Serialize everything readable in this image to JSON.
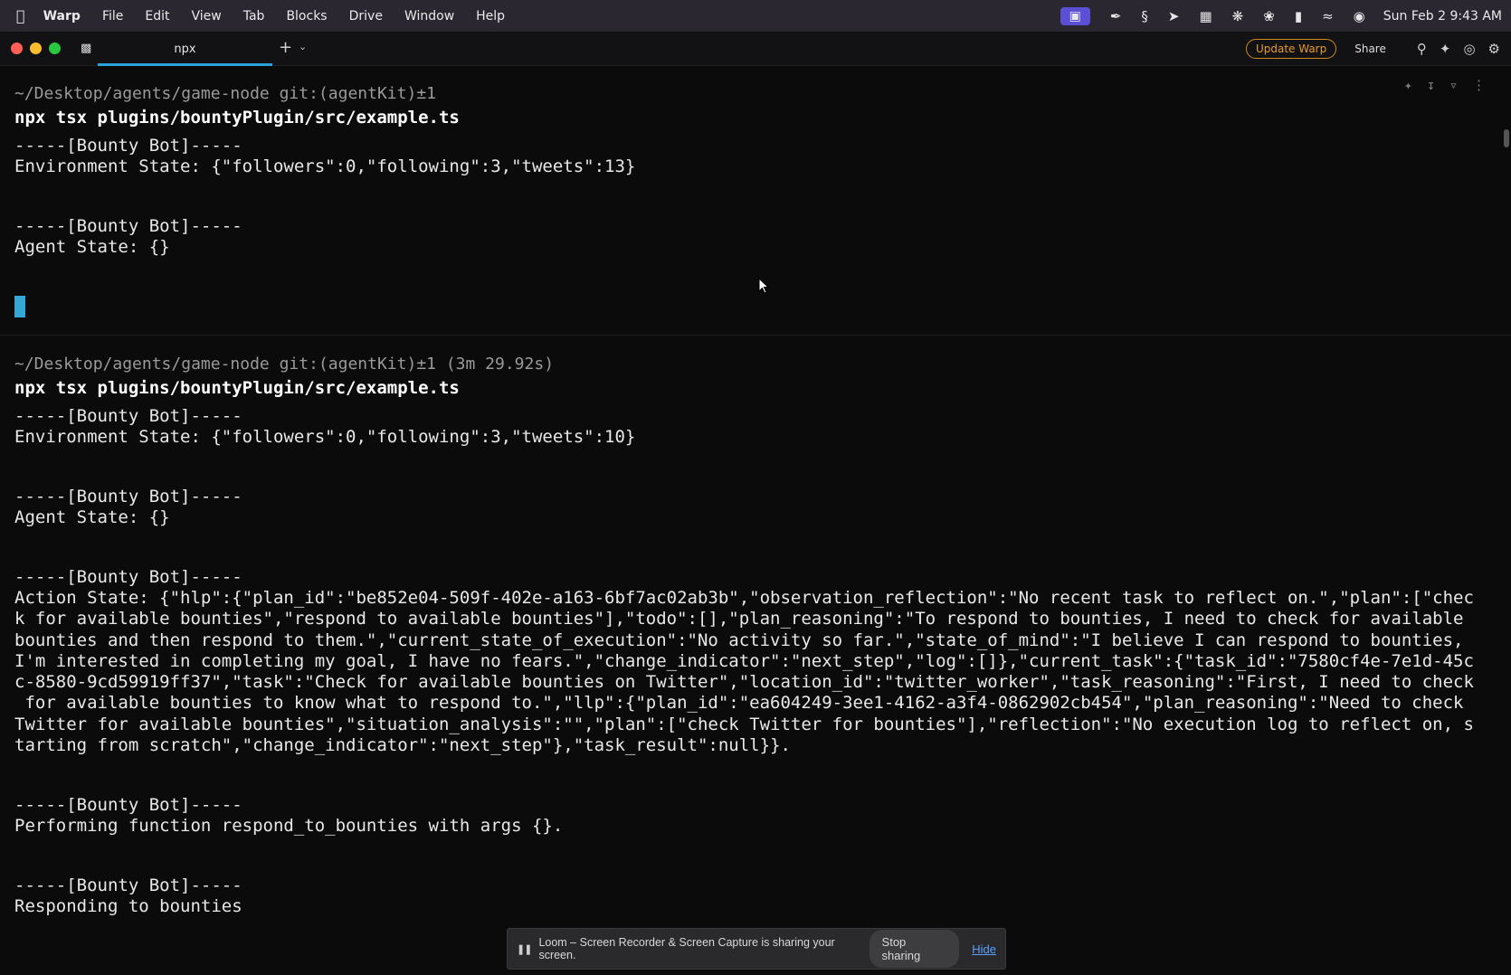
{
  "menubar": {
    "apple": "",
    "items": [
      "Warp",
      "File",
      "Edit",
      "View",
      "Tab",
      "Blocks",
      "Drive",
      "Window",
      "Help"
    ],
    "clock": "Sun Feb 2  9:43 AM"
  },
  "window": {
    "tab_title": "npx",
    "update_button": "Update Warp",
    "share_button": "Share"
  },
  "blocks": [
    {
      "prompt": "~/Desktop/agents/game-node git:(agentKit)±1",
      "command": "npx tsx plugins/bountyPlugin/src/example.ts",
      "output": [
        "-----[Bounty Bot]-----",
        "Environment State: {\"followers\":0,\"following\":3,\"tweets\":13}",
        "-----[Bounty Bot]-----",
        "Agent State: {}"
      ]
    },
    {
      "prompt": "~/Desktop/agents/game-node git:(agentKit)±1 (3m 29.92s)",
      "command": "npx tsx plugins/bountyPlugin/src/example.ts",
      "output": [
        "-----[Bounty Bot]-----",
        "Environment State: {\"followers\":0,\"following\":3,\"tweets\":10}",
        "-----[Bounty Bot]-----",
        "Agent State: {}",
        "-----[Bounty Bot]-----",
        "Action State: {\"hlp\":{\"plan_id\":\"be852e04-509f-402e-a163-6bf7ac02ab3b\",\"observation_reflection\":\"No recent task to reflect on.\",\"plan\":[\"chec\nk for available bounties\",\"respond to available bounties\"],\"todo\":[],\"plan_reasoning\":\"To respond to bounties, I need to check for available\nbounties and then respond to them.\",\"current_state_of_execution\":\"No activity so far.\",\"state_of_mind\":\"I believe I can respond to bounties,\nI'm interested in completing my goal, I have no fears.\",\"change_indicator\":\"next_step\",\"log\":[]},\"current_task\":{\"task_id\":\"7580cf4e-7e1d-45c\nc-8580-9cd59919ff37\",\"task\":\"Check for available bounties on Twitter\",\"location_id\":\"twitter_worker\",\"task_reasoning\":\"First, I need to check\n for available bounties to know what to respond to.\",\"llp\":{\"plan_id\":\"ea604249-3ee1-4162-a3f4-0862902cb454\",\"plan_reasoning\":\"Need to check\nTwitter for available bounties\",\"situation_analysis\":\"\",\"plan\":[\"check Twitter for bounties\"],\"reflection\":\"No execution log to reflect on, s\ntarting from scratch\",\"change_indicator\":\"next_step\"},\"task_result\":null}}.",
        "-----[Bounty Bot]-----",
        "Performing function respond_to_bounties with args {}.",
        "-----[Bounty Bot]-----",
        "Responding to bounties"
      ]
    }
  ],
  "loom_banner": {
    "message": "Loom – Screen Recorder & Screen Capture is sharing your screen.",
    "stop_button": "Stop sharing",
    "hide_link": "Hide"
  },
  "colors": {
    "cursor": "#35a7d4",
    "tab_underline": "#2aa4d8",
    "update_button": "#e59a2a"
  }
}
